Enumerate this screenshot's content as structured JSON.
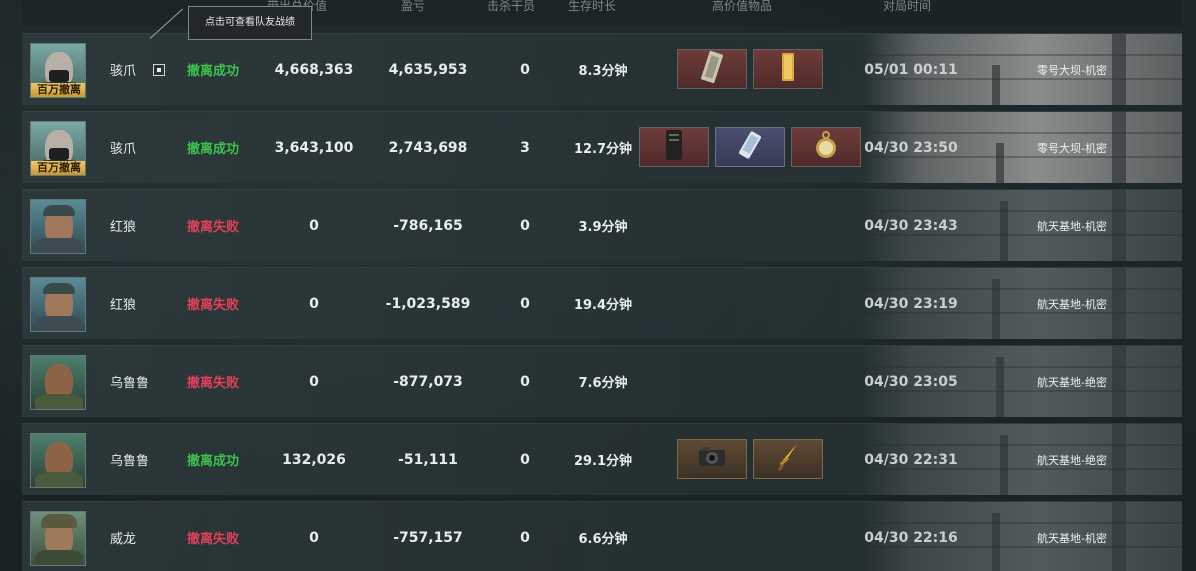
{
  "columns": {
    "value": "带出总价值",
    "profit": "盈亏",
    "kills": "击杀干员",
    "duration": "生存时长",
    "items": "高价值物品",
    "time": "对局时间"
  },
  "tooltip": "点击可查看队友战绩",
  "badge": "百万撤离",
  "rows": [
    {
      "name": "骇爪",
      "status": "撤离成功",
      "value": "4,668,363",
      "profit": "4,635,953",
      "kills": "0",
      "duration": "8.3分钟",
      "time": "05/01 00:11",
      "map": "零号大坝-机密",
      "badge": true,
      "items": [
        "red",
        "red"
      ]
    },
    {
      "name": "骇爪",
      "status": "撤离成功",
      "value": "3,643,100",
      "profit": "2,743,698",
      "kills": "3",
      "duration": "12.7分钟",
      "time": "04/30 23:50",
      "map": "零号大坝-机密",
      "badge": true,
      "items": [
        "red",
        "blue",
        "red"
      ]
    },
    {
      "name": "红狼",
      "status": "撤离失败",
      "value": "0",
      "profit": "-786,165",
      "kills": "0",
      "duration": "3.9分钟",
      "time": "04/30 23:43",
      "map": "航天基地-机密",
      "badge": false,
      "items": []
    },
    {
      "name": "红狼",
      "status": "撤离失败",
      "value": "0",
      "profit": "-1,023,589",
      "kills": "0",
      "duration": "19.4分钟",
      "time": "04/30 23:19",
      "map": "航天基地-机密",
      "badge": false,
      "items": []
    },
    {
      "name": "乌鲁鲁",
      "status": "撤离失败",
      "value": "0",
      "profit": "-877,073",
      "kills": "0",
      "duration": "7.6分钟",
      "time": "04/30 23:05",
      "map": "航天基地-绝密",
      "badge": false,
      "items": []
    },
    {
      "name": "乌鲁鲁",
      "status": "撤离成功",
      "value": "132,026",
      "profit": "-51,111",
      "kills": "0",
      "duration": "29.1分钟",
      "time": "04/30 22:31",
      "map": "航天基地-绝密",
      "badge": false,
      "items": [
        "gold",
        "gold"
      ]
    },
    {
      "name": "威龙",
      "status": "撤离失败",
      "value": "0",
      "profit": "-757,157",
      "kills": "0",
      "duration": "6.6分钟",
      "time": "04/30 22:16",
      "map": "航天基地-机密",
      "badge": false,
      "items": []
    }
  ],
  "item_icons": [
    [
      "gpu-card-icon",
      "gold-bar-icon"
    ],
    [
      "server-box-icon",
      "phone-icon",
      "pocket-watch-icon"
    ],
    [],
    [],
    [],
    [
      "camera-icon",
      "golden-dagger-icon"
    ],
    []
  ],
  "colors": {
    "success": "#3cc24c",
    "fail": "#e0405a",
    "badge": "#f0c867"
  }
}
